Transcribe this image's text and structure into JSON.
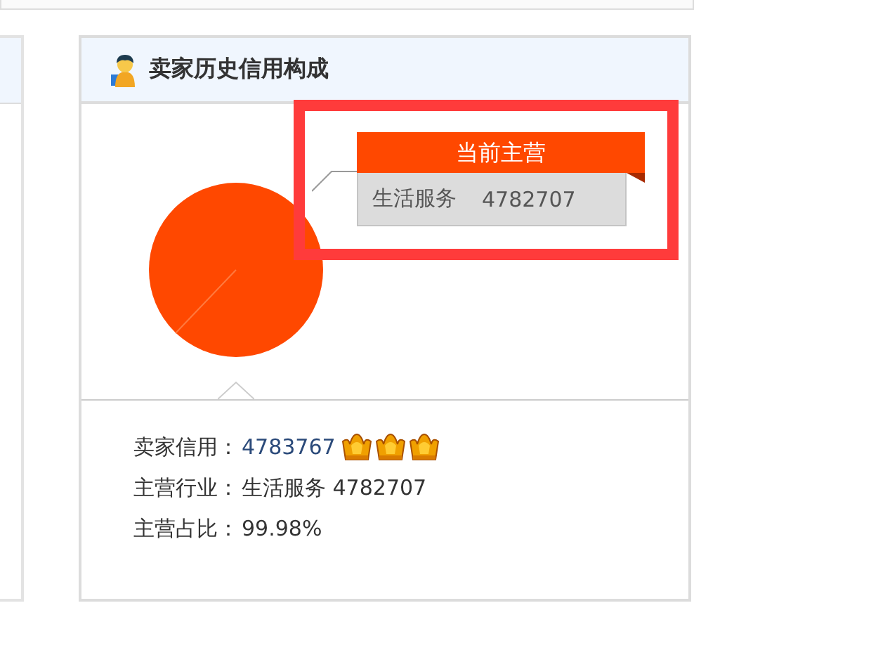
{
  "panel": {
    "title": "卖家历史信用构成"
  },
  "chart_tag": {
    "heading": "当前主营",
    "category": "生活服务",
    "value": "4782707"
  },
  "info_rows": [
    {
      "kind": "credit",
      "label": "卖家信用：",
      "value": "4783767",
      "stars": 3
    },
    {
      "kind": "plain",
      "label": "主营行业：",
      "value": "生活服务 4782707"
    },
    {
      "kind": "plain",
      "label": "主营占比：",
      "value": "99.98%"
    }
  ]
}
